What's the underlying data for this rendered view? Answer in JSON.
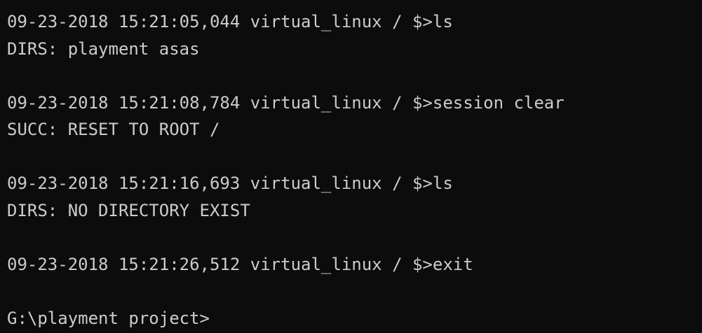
{
  "colors": {
    "background": "#0c0c0c",
    "foreground": "#cccccc"
  },
  "entries": [
    {
      "command": "09-23-2018 15:21:05,044 virtual_linux / $>ls",
      "output": "DIRS: playment asas"
    },
    {
      "command": "09-23-2018 15:21:08,784 virtual_linux / $>session clear",
      "output": "SUCC: RESET TO ROOT /"
    },
    {
      "command": "09-23-2018 15:21:16,693 virtual_linux / $>ls",
      "output": "DIRS: NO DIRECTORY EXIST"
    },
    {
      "command": "09-23-2018 15:21:26,512 virtual_linux / $>exit",
      "output": ""
    }
  ],
  "prompt": "G:\\playment project>"
}
